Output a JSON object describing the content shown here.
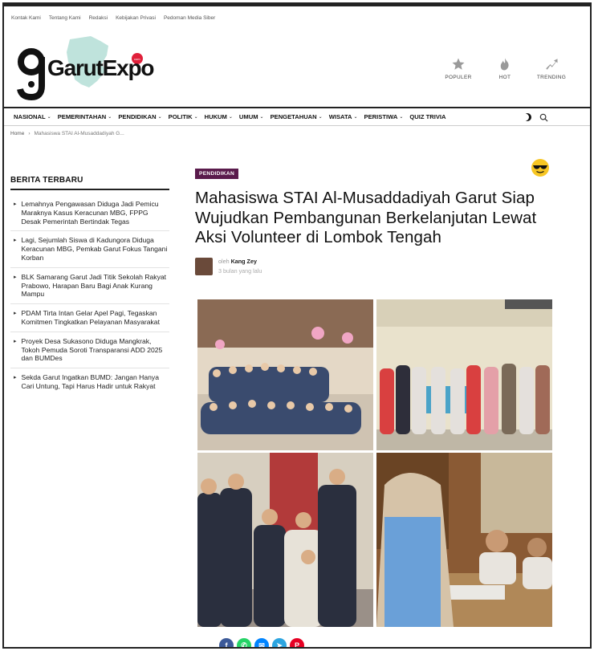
{
  "topbar": [
    "Kontak Kami",
    "Tentang Kami",
    "Redaksi",
    "Kebijakan Privasi",
    "Pedoman Media Siber"
  ],
  "logo": {
    "text": "GarutExpo",
    "badge": "com"
  },
  "header_actions": [
    {
      "label": "POPULER",
      "icon": "star-icon"
    },
    {
      "label": "HOT",
      "icon": "flame-icon"
    },
    {
      "label": "TRENDING",
      "icon": "trending-icon"
    }
  ],
  "nav": [
    {
      "label": "NASIONAL",
      "dropdown": true
    },
    {
      "label": "PEMERINTAHAN",
      "dropdown": true
    },
    {
      "label": "PENDIDIKAN",
      "dropdown": true
    },
    {
      "label": "POLITIK",
      "dropdown": true
    },
    {
      "label": "HUKUM",
      "dropdown": true
    },
    {
      "label": "UMUM",
      "dropdown": true
    },
    {
      "label": "PENGETAHUAN",
      "dropdown": true
    },
    {
      "label": "WISATA",
      "dropdown": true
    },
    {
      "label": "PERISTIWA",
      "dropdown": true
    },
    {
      "label": "QUIZ TRIVIA",
      "dropdown": false
    }
  ],
  "breadcrumb": {
    "home": "Home",
    "separator": "›",
    "current": "Mahasiswa STAI Al-Musaddadiyah G..."
  },
  "sidebar": {
    "title": "BERITA TERBARU",
    "items": [
      "Lemahnya Pengawasan Diduga Jadi Pemicu Maraknya Kasus Keracunan MBG, FPPG Desak Pemerintah Bertindak Tegas",
      "Lagi, Sejumlah Siswa di Kadungora Diduga Keracunan MBG, Pemkab Garut Fokus Tangani Korban",
      "BLK Samarang Garut Jadi Titik Sekolah Rakyat Prabowo, Harapan Baru Bagi Anak Kurang Mampu",
      "PDAM Tirta Intan Gelar Apel Pagi, Tegaskan Komitmen Tingkatkan Pelayanan Masyarakat",
      "Proyek Desa Sukasono Diduga Mangkrak, Tokoh Pemuda Soroti Transparansi ADD 2025 dan BUMDes",
      "Sekda Garut Ingatkan BUMD: Jangan Hanya Cari Untung, Tapi Harus Hadir untuk Rakyat"
    ]
  },
  "article": {
    "category": "PENDIDIKAN",
    "title": "Mahasiswa STAI Al-Musaddadiyah Garut Siap Wujudkan Pembangunan Berkelanjutan Lewat Aksi Volunteer di Lombok Tengah",
    "author_prefix": "oleh",
    "author": "Kang Zey",
    "time": "3 bulan yang lalu"
  },
  "share": [
    {
      "icon": "facebook-icon",
      "glyph": "f",
      "color": "#3b5998"
    },
    {
      "icon": "whatsapp-icon",
      "glyph": "✆",
      "color": "#25d366"
    },
    {
      "icon": "messenger-icon",
      "glyph": "✉",
      "color": "#0084ff"
    },
    {
      "icon": "telegram-icon",
      "glyph": "➤",
      "color": "#2ca5e0"
    },
    {
      "icon": "pinterest-icon",
      "glyph": "P",
      "color": "#e60023"
    }
  ]
}
